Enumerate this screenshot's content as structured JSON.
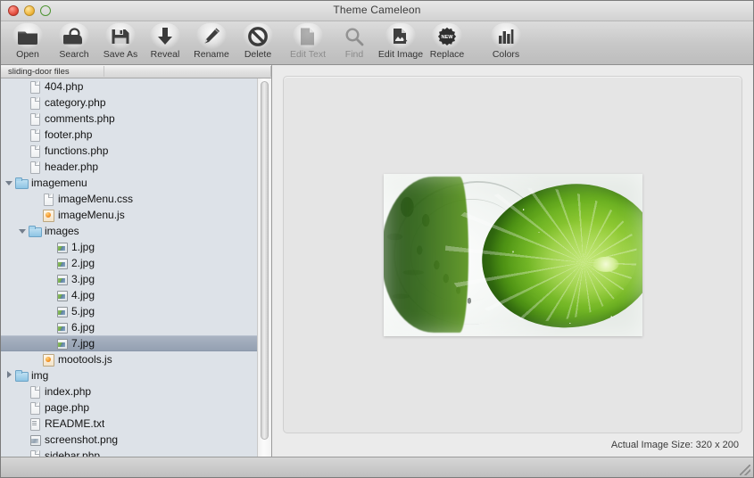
{
  "window": {
    "title": "Theme Cameleon",
    "controls": [
      {
        "name": "close",
        "color": "#e24b3c"
      },
      {
        "name": "minimize",
        "color": "#efb53a"
      },
      {
        "name": "zoom",
        "color": "#66bc44"
      }
    ]
  },
  "toolbar": {
    "groups": [
      {
        "id": "file",
        "items": [
          {
            "label": "Open",
            "icon": "folder-icon",
            "enabled": true
          },
          {
            "label": "Search",
            "icon": "search-bag-icon",
            "enabled": true
          },
          {
            "label": "Save As",
            "icon": "floppy-disk-icon",
            "enabled": true
          }
        ]
      },
      {
        "id": "item-actions",
        "items": [
          {
            "label": "Reveal",
            "icon": "down-arrow-icon",
            "enabled": true
          },
          {
            "label": "Rename",
            "icon": "pencil-icon",
            "enabled": true
          },
          {
            "label": "Delete",
            "icon": "prohibition-icon",
            "enabled": true
          }
        ]
      },
      {
        "id": "edit-actions",
        "items": [
          {
            "label": "Edit Text",
            "icon": "document-edit-icon",
            "enabled": false
          },
          {
            "label": "Find",
            "icon": "magnifier-icon",
            "enabled": false
          },
          {
            "label": "Edit Image",
            "icon": "image-edit-icon",
            "enabled": true
          },
          {
            "label": "Replace",
            "icon": "new-badge-icon",
            "enabled": true
          }
        ]
      },
      {
        "id": "palette",
        "items": [
          {
            "label": "Colors",
            "icon": "bar-chart-icon",
            "enabled": true
          }
        ]
      }
    ]
  },
  "sidebar": {
    "column_header": "sliding-door files",
    "tree": [
      {
        "label": "404.php",
        "icon": "php-file-icon",
        "indent": 1,
        "twisty": "none",
        "selected": false
      },
      {
        "label": "category.php",
        "icon": "php-file-icon",
        "indent": 1,
        "twisty": "none",
        "selected": false
      },
      {
        "label": "comments.php",
        "icon": "php-file-icon",
        "indent": 1,
        "twisty": "none",
        "selected": false
      },
      {
        "label": "footer.php",
        "icon": "php-file-icon",
        "indent": 1,
        "twisty": "none",
        "selected": false
      },
      {
        "label": "functions.php",
        "icon": "php-file-icon",
        "indent": 1,
        "twisty": "none",
        "selected": false
      },
      {
        "label": "header.php",
        "icon": "php-file-icon",
        "indent": 1,
        "twisty": "none",
        "selected": false
      },
      {
        "label": "imagemenu",
        "icon": "folder-icon",
        "indent": 0,
        "twisty": "open",
        "selected": false
      },
      {
        "label": "imageMenu.css",
        "icon": "css-file-icon",
        "indent": 2,
        "twisty": "none",
        "selected": false
      },
      {
        "label": "imageMenu.js",
        "icon": "js-file-icon",
        "indent": 2,
        "twisty": "none",
        "selected": false
      },
      {
        "label": "images",
        "icon": "folder-icon",
        "indent": 1,
        "twisty": "open",
        "selected": false
      },
      {
        "label": "1.jpg",
        "icon": "jpg-file-icon",
        "indent": 3,
        "twisty": "none",
        "selected": false
      },
      {
        "label": "2.jpg",
        "icon": "jpg-file-icon",
        "indent": 3,
        "twisty": "none",
        "selected": false
      },
      {
        "label": "3.jpg",
        "icon": "jpg-file-icon",
        "indent": 3,
        "twisty": "none",
        "selected": false
      },
      {
        "label": "4.jpg",
        "icon": "jpg-file-icon",
        "indent": 3,
        "twisty": "none",
        "selected": false
      },
      {
        "label": "5.jpg",
        "icon": "jpg-file-icon",
        "indent": 3,
        "twisty": "none",
        "selected": false
      },
      {
        "label": "6.jpg",
        "icon": "jpg-file-icon",
        "indent": 3,
        "twisty": "none",
        "selected": false
      },
      {
        "label": "7.jpg",
        "icon": "jpg-file-icon",
        "indent": 3,
        "twisty": "none",
        "selected": true
      },
      {
        "label": "mootools.js",
        "icon": "js-file-icon",
        "indent": 2,
        "twisty": "none",
        "selected": false
      },
      {
        "label": "img",
        "icon": "folder-icon",
        "indent": 0,
        "twisty": "closed",
        "selected": false
      },
      {
        "label": "index.php",
        "icon": "php-file-icon",
        "indent": 1,
        "twisty": "none",
        "selected": false
      },
      {
        "label": "page.php",
        "icon": "php-file-icon",
        "indent": 1,
        "twisty": "none",
        "selected": false
      },
      {
        "label": "README.txt",
        "icon": "txt-file-icon",
        "indent": 1,
        "twisty": "none",
        "selected": false
      },
      {
        "label": "screenshot.png",
        "icon": "png-file-icon",
        "indent": 1,
        "twisty": "none",
        "selected": false
      },
      {
        "label": "sidebar.php",
        "icon": "php-file-icon",
        "indent": 1,
        "twisty": "none",
        "selected": false
      }
    ],
    "selection_color": "#94a0b2"
  },
  "preview": {
    "image_alt": "lime-wedge-water-splash-photo",
    "status": "Actual Image Size: 320 x 200"
  }
}
